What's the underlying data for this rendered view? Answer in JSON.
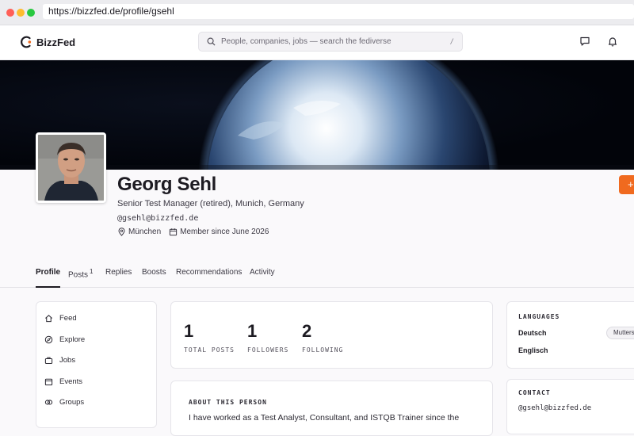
{
  "browser": {
    "url": "https://bizzfed.de/profile/gsehl"
  },
  "header": {
    "brand": "BizzFed",
    "search_placeholder": "People, companies, jobs — search the fediverse",
    "search_shortcut": "/"
  },
  "profile": {
    "name": "Georg Sehl",
    "headline": "Senior Test Manager (retired), Munich, Germany",
    "handle": "@gsehl@bizzfed.de",
    "location": "München",
    "member_since": "Member since June 2026",
    "follow_label": "+"
  },
  "tabs": [
    {
      "label": "Profile",
      "active": true
    },
    {
      "label": "Posts",
      "count": "1"
    },
    {
      "label": "Replies"
    },
    {
      "label": "Boosts"
    },
    {
      "label": "Recommendations"
    },
    {
      "label": "Activity"
    }
  ],
  "sidebar": {
    "items": [
      {
        "label": "Feed",
        "icon": "home-icon"
      },
      {
        "label": "Explore",
        "icon": "compass-icon"
      },
      {
        "label": "Jobs",
        "icon": "briefcase-icon"
      },
      {
        "label": "Events",
        "icon": "calendar-icon"
      },
      {
        "label": "Groups",
        "icon": "groups-icon"
      }
    ]
  },
  "stats": [
    {
      "value": "1",
      "label": "TOTAL POSTS"
    },
    {
      "value": "1",
      "label": "FOLLOWERS"
    },
    {
      "value": "2",
      "label": "FOLLOWING"
    }
  ],
  "about": {
    "title": "ABOUT THIS PERSON",
    "text": "I have worked as a Test Analyst, Consultant, and ISTQB Trainer since the"
  },
  "languages": {
    "title": "LANGUAGES",
    "items": [
      {
        "name": "Deutsch",
        "level": "Mutters"
      },
      {
        "name": "Englisch"
      }
    ]
  },
  "contact": {
    "title": "CONTACT",
    "handle": "@gsehl@bizzfed.de"
  },
  "colors": {
    "accent": "#f06a1f",
    "text": "#1d1b22"
  }
}
